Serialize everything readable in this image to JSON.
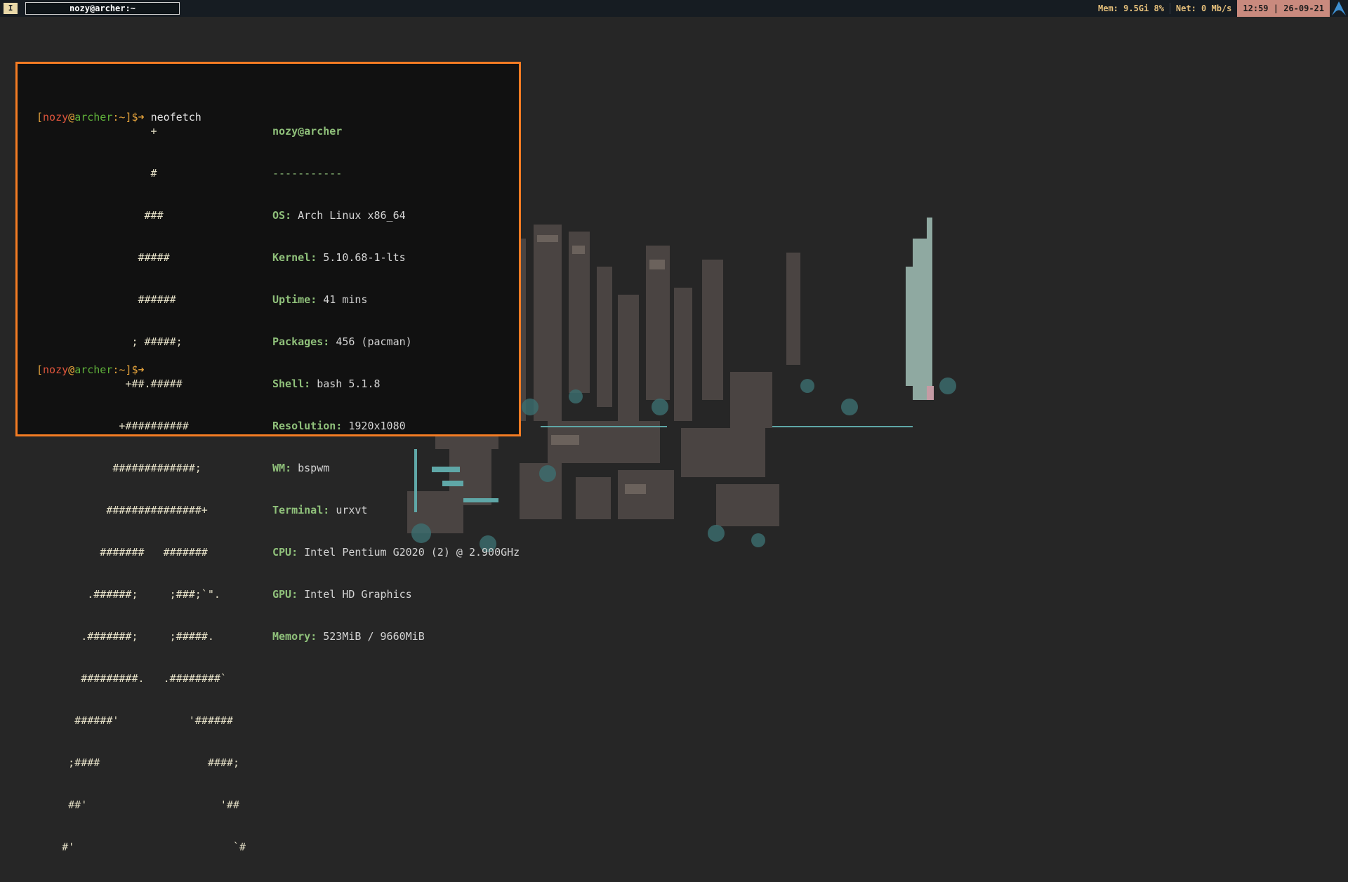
{
  "topbar": {
    "workspace": "I",
    "window_title": "nozy@archer:~",
    "mem": "Mem: 9.5Gi 8%",
    "net": "Net: 0 Mb/s",
    "clock": "12:59 | 26-09-21",
    "icon": "arch-logo-icon",
    "accent": "#e6c07b",
    "clock_bg": "#c98a7e"
  },
  "terminal": {
    "border_color": "#f47c23",
    "prompt": {
      "open": "[",
      "user": "nozy",
      "at": "@",
      "host": "archer",
      "path": ":~",
      "close": "]$",
      "arrow": "➜"
    },
    "command": "neofetch",
    "logo_lines": [
      "                  +",
      "                  #",
      "                 ###",
      "                #####",
      "                ######",
      "               ; #####;",
      "              +##.#####",
      "             +##########",
      "            #############;",
      "           ###############+",
      "          #######   #######",
      "        .######;     ;###;`\".",
      "       .#######;     ;#####.",
      "       #########.   .########`",
      "      ######'           '######",
      "     ;####                 ####;",
      "     ##'                     '##",
      "    #'                         `#"
    ],
    "info_title": "nozy@archer",
    "info_separator": "-----------",
    "info": [
      {
        "key": "OS",
        "value": "Arch Linux x86_64"
      },
      {
        "key": "Kernel",
        "value": "5.10.68-1-lts"
      },
      {
        "key": "Uptime",
        "value": "41 mins"
      },
      {
        "key": "Packages",
        "value": "456 (pacman)"
      },
      {
        "key": "Shell",
        "value": "bash 5.1.8"
      },
      {
        "key": "Resolution",
        "value": "1920x1080"
      },
      {
        "key": "WM",
        "value": "bspwm"
      },
      {
        "key": "Terminal",
        "value": "urxvt"
      },
      {
        "key": "CPU",
        "value": "Intel Pentium G2020 (2) @ 2.900GHz"
      },
      {
        "key": "GPU",
        "value": "Intel HD Graphics"
      },
      {
        "key": "Memory",
        "value": "523MiB / 9660MiB"
      }
    ]
  }
}
